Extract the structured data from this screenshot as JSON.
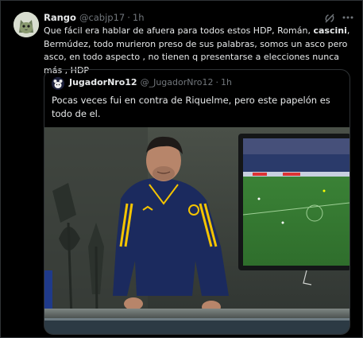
{
  "tweet": {
    "author_name": "Rango",
    "author_handle": "@cabjp17",
    "separator": "·",
    "time": "1h",
    "text_part1": "Que fácil era hablar de afuera para todos estos HDP, Román, ",
    "text_bold": "cascini",
    "text_part2": ", Bermúdez, todo murieron preso de sus palabras, somos un asco pero asco, en todo aspecto , no tienen q presentarse a elecciones nunca más , HDP"
  },
  "quote": {
    "author_name": "JugadorNro12",
    "author_handle": "@_JugadorNro12",
    "separator": "·",
    "time": "1h",
    "text": "Pocas veces fui en contra de Riquelme, pero este papelón es todo de el."
  },
  "icons": {
    "grok": "grok-icon",
    "more": "more-icon",
    "avatar": "cat-avatar",
    "quote_avatar": "bear-avatar"
  },
  "colors": {
    "background": "#000000",
    "text": "#e7e9ea",
    "muted": "#71767b",
    "border": "#2f3336",
    "boca_blue": "#1b2a5e",
    "boca_yellow": "#f4c400"
  }
}
